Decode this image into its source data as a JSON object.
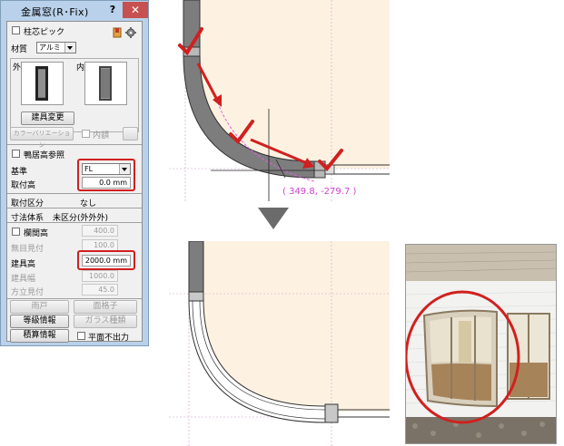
{
  "dialog": {
    "title": "金属窓(R･Fix)",
    "help_label": "?",
    "close_label": "✕",
    "pillar_pick_label": "柱芯ピック",
    "material_label": "材質",
    "material_value": "アルミ",
    "outside_label": "外",
    "inside_label": "内",
    "change_fitting_label": "建具変更",
    "color_variation_label": "カラーバリエーション",
    "inner_frame_label": "内額",
    "sill_height_ref_label": "鴨居高参照",
    "reference_label": "基準",
    "reference_value": "FL",
    "mount_height_label": "取付高",
    "mount_height_value": "0.0 mm",
    "mount_class_label": "取付区分",
    "mount_class_value": "なし",
    "dimension_system_label": "寸法体系",
    "dimension_system_value": "未区分(外外外)",
    "transom_height_label": "欄間高",
    "transom_height_value": "400.0",
    "no_mullion_label": "無目見付",
    "no_mullion_value": "100.0",
    "fitting_height_label": "建具高",
    "fitting_height_value": "2000.0 mm",
    "fitting_width_label": "建具幅",
    "fitting_width_value": "1000.0",
    "mullion_label": "方立見付",
    "mullion_value": "45.0",
    "shutter_label": "雨戸",
    "grille_label": "面格子",
    "grade_info_label": "等級情報",
    "glass_type_label": "ガラス種類",
    "estimate_info_label": "積算情報",
    "no_plan_output_label": "平面不出力"
  },
  "canvas": {
    "coordinate_readout": "( 349.8, -279.7 )"
  },
  "colors": {
    "accent_red": "#d0201f",
    "wall_fill": "#fdf2e2",
    "window_frame": "#7d7d7d"
  }
}
